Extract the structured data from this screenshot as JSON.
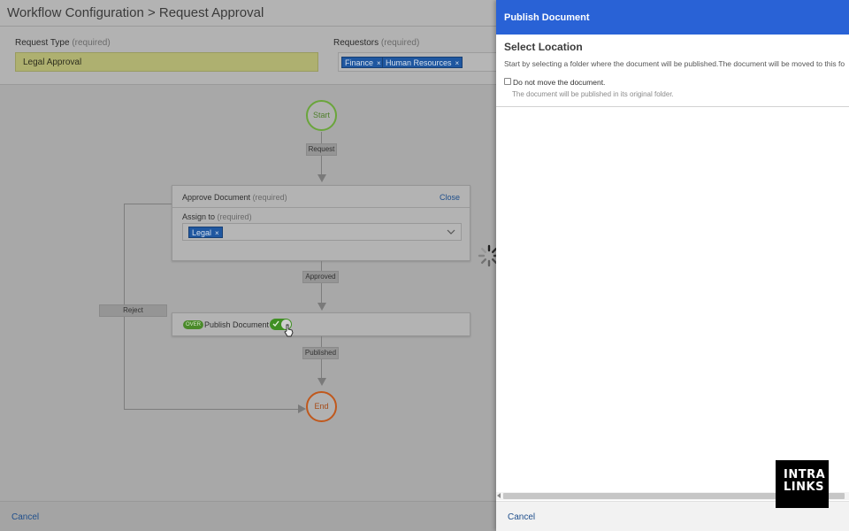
{
  "header": {
    "title": "Workflow Configuration > Request Approval"
  },
  "form": {
    "request_type_label": "Request Type",
    "request_type_req": "(required)",
    "request_type_value": "Legal Approval",
    "requestors_label": "Requestors",
    "requestors_req": "(required)",
    "requestors": [
      "Finance",
      "Human Resources"
    ]
  },
  "workflow": {
    "start_label": "Start",
    "end_label": "End",
    "edge_request": "Request",
    "edge_approved": "Approved",
    "edge_published": "Published",
    "edge_reject": "Reject",
    "approve_card": {
      "title": "Approve Document",
      "title_req": "(required)",
      "close_label": "Close",
      "assign_label": "Assign to",
      "assign_req": "(required)",
      "assignee": "Legal"
    },
    "publish_card": {
      "badge": "OVER",
      "title": "Publish Document"
    }
  },
  "footer": {
    "cancel_label": "Cancel"
  },
  "panel": {
    "title": "Publish Document",
    "section_title": "Select Location",
    "description": "Start by selecting a folder where the document will be published.The document will be moved to this fo",
    "checkbox_label": "Do not move the document.",
    "checkbox_help": "The document will be published in its original folder.",
    "cancel_label": "Cancel"
  },
  "logo": {
    "line1": "INTRA",
    "line2": "LINKS"
  },
  "colors": {
    "panel_header": "#2962d6",
    "tag_blue": "#1f57a0",
    "start_node": "#6aa53b",
    "end_node": "#c0581c",
    "toggle_on": "#3f8f22",
    "link": "#1f4f8c"
  }
}
